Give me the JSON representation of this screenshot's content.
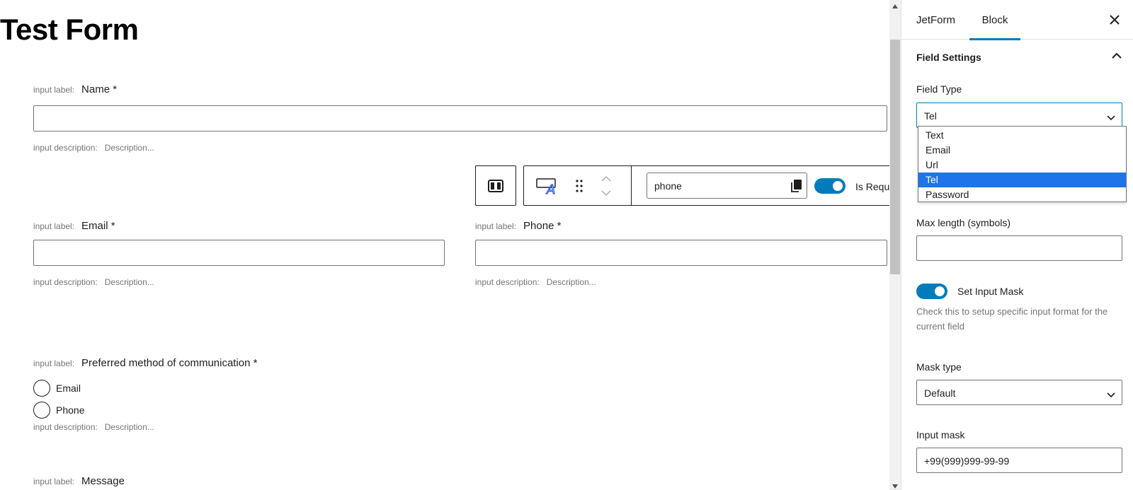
{
  "canvas": {
    "form_title": "Test Form",
    "label_prefix": "input label:",
    "description_prefix": "input description:",
    "description_placeholder": "Description...",
    "fields": {
      "name": {
        "label": "Name *"
      },
      "email": {
        "label": "Email *"
      },
      "phone": {
        "label": "Phone *"
      },
      "preferred": {
        "label": "Preferred method of communication *",
        "options": [
          "Email",
          "Phone"
        ]
      },
      "message": {
        "label": "Message"
      }
    },
    "toolbar": {
      "field_name_value": "phone",
      "required_label": "Is Required",
      "required_on": true
    }
  },
  "sidebar": {
    "tabs": [
      {
        "label": "JetForm",
        "active": false
      },
      {
        "label": "Block",
        "active": true
      }
    ],
    "panel_title": "Field Settings",
    "field_type": {
      "label": "Field Type",
      "value": "Tel",
      "options": [
        "Text",
        "Email",
        "Url",
        "Tel",
        "Password"
      ],
      "selected_index": 3
    },
    "max_length": {
      "label": "Max length (symbols)",
      "value": ""
    },
    "input_mask_toggle": {
      "label": "Set Input Mask",
      "on": true
    },
    "help_text": "Check this to setup specific input format for the current field",
    "mask_type": {
      "label": "Mask type",
      "value": "Default"
    },
    "input_mask": {
      "label": "Input mask",
      "value": "+99(999)999-99-99"
    }
  },
  "colors": {
    "accent": "#007cba",
    "dropdown_highlight": "#1e74e8",
    "muted_text": "#757575"
  },
  "icons": {
    "close": "close-icon",
    "collapse": "chevron-up-icon",
    "select_arrow": "chevron-down-icon",
    "copy": "copy-icon",
    "drag": "drag-handle-icon",
    "move_up": "chevron-up-icon",
    "move_down": "chevron-down-icon",
    "block_type": "text-field-block-icon",
    "columns": "columns-icon"
  }
}
